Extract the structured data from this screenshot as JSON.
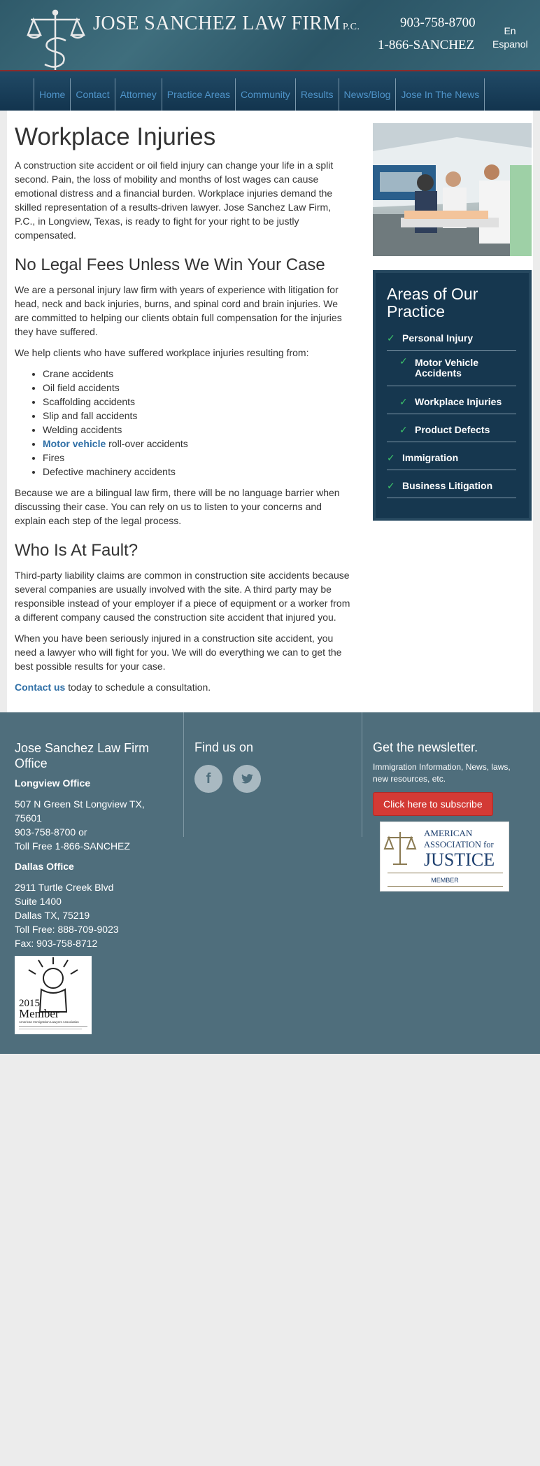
{
  "header": {
    "firm_name": "Jose Sanchez Law Firm",
    "firm_suffix": "P.C.",
    "phone_local": "903-758-8700",
    "phone_toll_free": "1-866-SANCHEZ",
    "lang_en": "En",
    "lang_es": "Espanol"
  },
  "nav": {
    "items": [
      "Home",
      "Contact",
      "Attorney",
      "Practice Areas",
      "Community",
      "Results",
      "News/Blog",
      "Jose In The News"
    ]
  },
  "content": {
    "title": "Workplace Injuries",
    "intro": "A construction site accident or oil field injury can change your life in a split second. Pain, the loss of mobility and months of lost wages can cause emotional distress and a financial burden. Workplace injuries demand the skilled representation of a results-driven lawyer. Jose Sanchez Law Firm, P.C., in Longview, Texas, is ready to fight for your right to be justly compensated.",
    "h2_fees": "No Legal Fees Unless We Win Your Case",
    "p_firm": "We are a personal injury law firm with years of experience with litigation for head, neck and back injuries, burns, and spinal cord and brain injuries. We are committed to helping our clients obtain full compensation for the injuries they have suffered.",
    "p_help": "We help clients who have suffered workplace injuries resulting from:",
    "list": [
      "Crane accidents",
      "Oil field accidents",
      "Scaffolding accidents",
      "Slip and fall accidents",
      "Welding accidents"
    ],
    "motor_link": "Motor vehicle",
    "motor_rest": " roll-over accidents",
    "list2": [
      "Fires",
      "Defective machinery accidents"
    ],
    "p_bilingual": "Because we are a bilingual law firm, there will be no language barrier when discussing their case. You can rely on us to listen to your concerns and explain each step of the legal process.",
    "h2_fault": "Who Is At Fault?",
    "p_fault": "Third-party liability claims are common in construction site accidents because several companies are usually involved with the site. A third party may be responsible instead of your employer if a piece of equipment or a worker from a different company caused the construction site accident that injured you.",
    "p_injured": "When you have been seriously injured in a construction site accident, you need a lawyer who will fight for you. We will do everything we can to get the best possible results for your case.",
    "contact_link": "Contact us",
    "contact_rest": " today to schedule a consultation."
  },
  "sidebar": {
    "title": "Areas of Our Practice",
    "items": [
      {
        "label": "Personal Injury",
        "level": "top"
      },
      {
        "label": "Motor Vehicle Accidents",
        "level": "sub"
      },
      {
        "label": "Workplace Injuries",
        "level": "sub"
      },
      {
        "label": "Product Defects",
        "level": "sub"
      },
      {
        "label": "Immigration",
        "level": "top"
      },
      {
        "label": "Business Litigation",
        "level": "top"
      }
    ]
  },
  "footer": {
    "firm_title": "Jose Sanchez Law Firm Office",
    "longview_label": "Longview Office",
    "longview_lines": [
      "507 N Green St Longview TX, 75601",
      "903-758-8700 or",
      "Toll Free 1-866-SANCHEZ"
    ],
    "dallas_label": "Dallas Office",
    "dallas_lines": [
      "2911 Turtle Creek Blvd",
      "Suite 1400",
      "Dallas TX, 75219",
      "Toll Free: 888-709-9023",
      "Fax: 903-758-8712"
    ],
    "find_us": "Find us on",
    "newsletter_title": "Get the newsletter.",
    "newsletter_desc": "Immigration Information, News, laws, new resources, etc.",
    "subscribe_label": "Click here to subscribe",
    "badge_year": "2015",
    "badge_member": "Member",
    "badge_org": "American Immigration Lawyers Association",
    "aaj_line1": "AMERICAN",
    "aaj_line2": "ASSOCIATION for",
    "aaj_line3": "JUSTICE",
    "aaj_line4": "MEMBER"
  },
  "colors": {
    "header": "#2f5a6a",
    "nav_link": "#4f94c9",
    "practice_bg": "#16374f",
    "check": "#3cc36a",
    "footer": "#4f6e7c",
    "subscribe": "#d33a35"
  }
}
